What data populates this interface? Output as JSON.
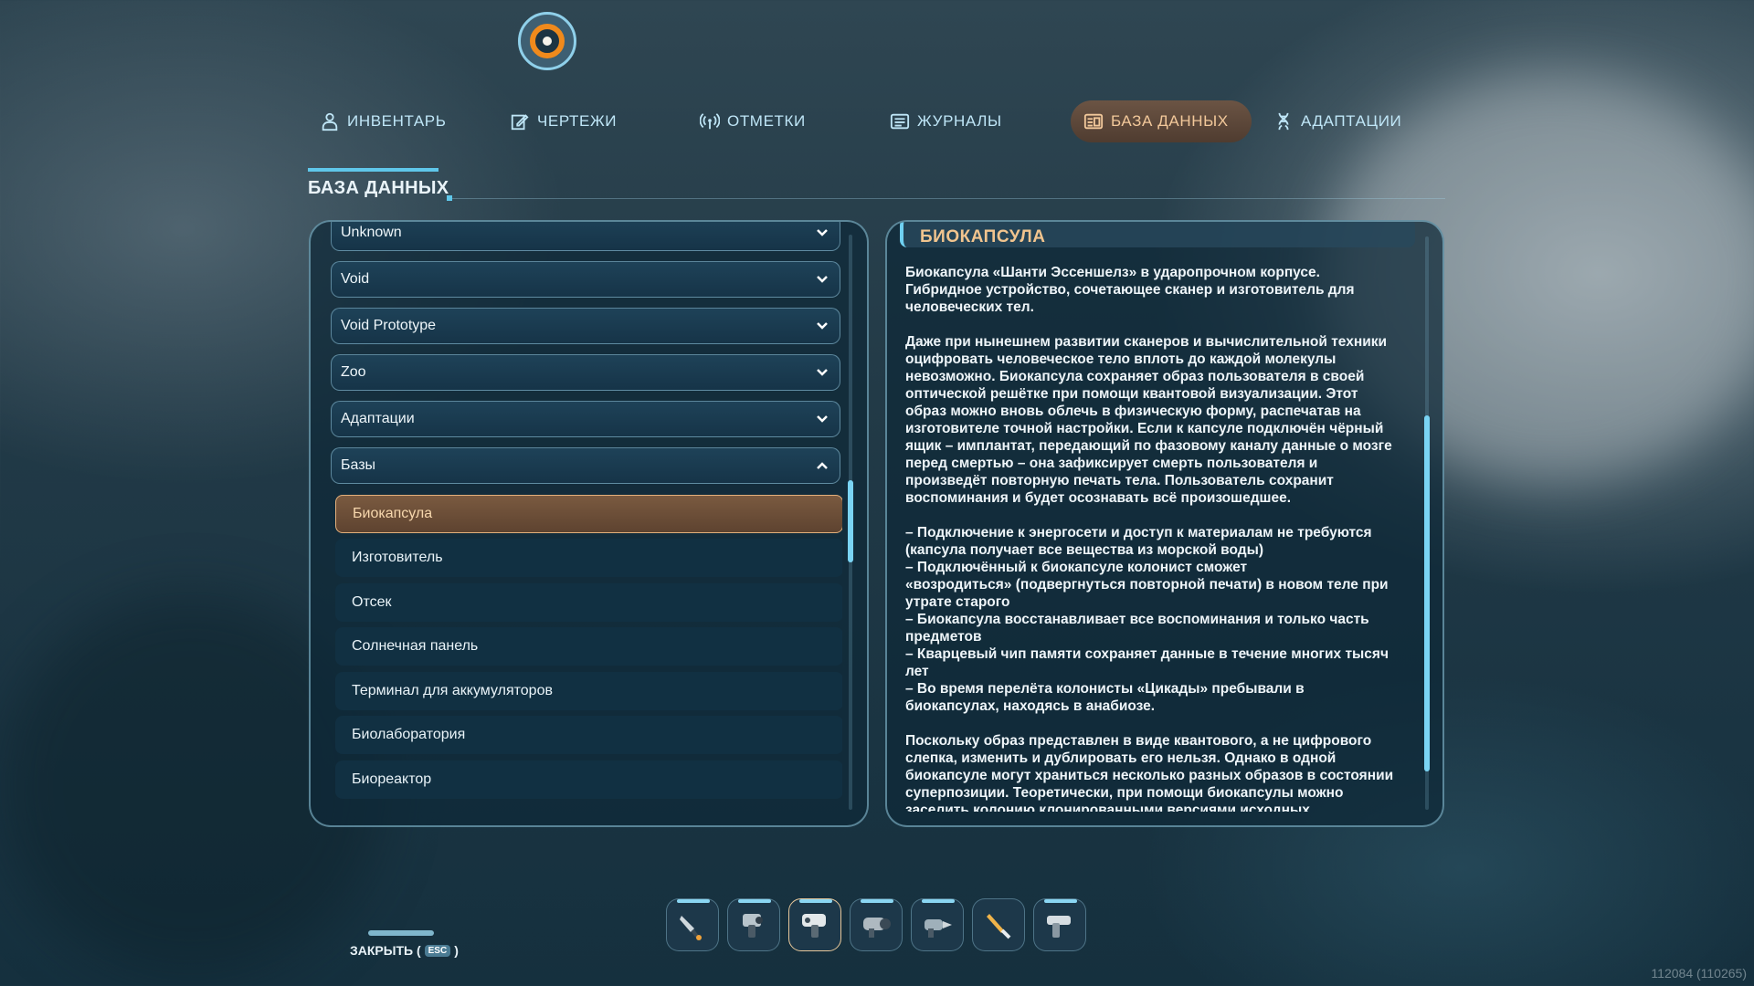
{
  "tabs": [
    {
      "label": "ИНВЕНТАРЬ",
      "icon": "person-icon"
    },
    {
      "label": "ЧЕРТЕЖИ",
      "icon": "blueprint-icon"
    },
    {
      "label": "ОТМЕТКИ",
      "icon": "signal-icon"
    },
    {
      "label": "ЖУРНАЛЫ",
      "icon": "log-icon"
    },
    {
      "label": "БАЗА ДАННЫХ",
      "icon": "database-icon",
      "active": true
    },
    {
      "label": "АДАПТАЦИИ",
      "icon": "dna-icon"
    }
  ],
  "section_title": "БАЗА ДАННЫХ",
  "categories": [
    {
      "label": "Unknown",
      "expanded": false
    },
    {
      "label": "Void",
      "expanded": false
    },
    {
      "label": "Void Prototype",
      "expanded": false
    },
    {
      "label": "Zoo",
      "expanded": false
    },
    {
      "label": "Адаптации",
      "expanded": false
    },
    {
      "label": "Базы",
      "expanded": true
    }
  ],
  "entries": [
    {
      "label": "Биокапсула",
      "selected": true
    },
    {
      "label": "Изготовитель"
    },
    {
      "label": "Отсек"
    },
    {
      "label": "Солнечная панель"
    },
    {
      "label": "Терминал для аккумуляторов"
    },
    {
      "label": "Биолаборатория"
    },
    {
      "label": "Биореактор"
    }
  ],
  "article": {
    "title": "БИОКАПСУЛА",
    "paragraphs": [
      "Биокапсула «Шанти Эссеншелз» в ударопрочном корпусе.\nГибридное устройство, сочетающее сканер и изготовитель для\nчеловеческих тел.",
      "Даже при нынешнем развитии сканеров и вычислительной техники\nоцифровать человеческое тело вплоть до каждой молекулы\nневозможно. Биокапсула сохраняет образ пользователя в своей\nоптической решётке при помощи квантовой визуализации. Этот\nобраз можно вновь облечь в физическую форму, распечатав на\nизготовителе точной настройки. Если к капсуле подключён чёрный\nящик – имплантат, передающий по фазовому каналу данные о мозге\nперед смертью – она зафиксирует смерть пользователя и\nпроизведёт повторную печать тела. Пользователь сохранит\nвоспоминания и будет осознавать всё произошедшее.",
      "– Подключение к энергосети и доступ к материалам не требуются\n(капсула получает все вещества из морской воды)\n– Подключённый к биокапсуле колонист сможет\n«возродиться» (подвергнуться повторной печати) в новом теле при\nутрате старого\n– Биокапсула восстанавливает все воспоминания и только часть\nпредметов\n– Кварцевый чип памяти сохраняет данные в течение многих тысяч\nлет\n– Во время перелёта колонисты «Цикады» пребывали в\nбиокапсулах, находясь в анабиозе.",
      "Поскольку образ представлен в виде квантового, а не цифрового\nслепка, изменить и дублировать его нельзя. Однако в одной\nбиокапсуле могут храниться несколько разных образов в состоянии\nсуперпозиции. Теоретически, при помощи биокапсулы можно\nзаселить колонию клонированными версиями исходных"
    ]
  },
  "hotbar": [
    {
      "icon": "scanner-tool-icon"
    },
    {
      "icon": "repair-tool-icon"
    },
    {
      "icon": "builder-tool-icon",
      "active": true
    },
    {
      "icon": "propulsion-tool-icon"
    },
    {
      "icon": "drill-tool-icon"
    },
    {
      "icon": "knife-tool-icon"
    },
    {
      "icon": "gun-tool-icon"
    }
  ],
  "close": {
    "label": "ЗАКРЫТЬ (",
    "key": "ESC",
    "suffix": ")"
  },
  "build_number": "112084 (110265)",
  "colors": {
    "accent": "#5fc7ea",
    "active_tab": "#6b5444",
    "highlight_text": "#f1c48e"
  }
}
